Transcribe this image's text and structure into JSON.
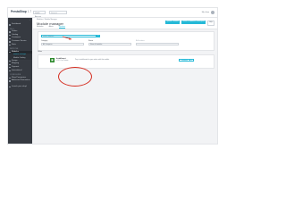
{
  "topbar": {
    "logo": "PrestaShop",
    "version": "1.7",
    "quick_access": "Quick Access",
    "search_placeholder": "Search",
    "store_label": "My shop",
    "user_icon": "user-avatar-icon"
  },
  "sidebar": {
    "collapse_icon": "chevron-left-icon",
    "items_top": [
      {
        "label": "Dashboard"
      }
    ],
    "section_sell": "SELL",
    "items_sell": [
      {
        "label": "Orders"
      },
      {
        "label": "Catalog"
      },
      {
        "label": "Customers"
      },
      {
        "label": "Customer Service"
      },
      {
        "label": "Stats"
      }
    ],
    "section_improve": "IMPROVE",
    "items_improve": [
      {
        "label": "Modules"
      }
    ],
    "modules_sub": [
      {
        "label": "Module Manager"
      },
      {
        "label": "Module Catalog"
      }
    ],
    "items_improve_more": [
      {
        "label": "Design"
      },
      {
        "label": "Shipping"
      },
      {
        "label": "Payment"
      },
      {
        "label": "International"
      }
    ],
    "section_configure": "CONFIGURE",
    "items_configure": [
      {
        "label": "Shop Parameters"
      },
      {
        "label": "Advanced Parameters"
      }
    ],
    "items_bottom": [
      {
        "label": "Launch your shop!"
      }
    ]
  },
  "header": {
    "breadcrumb": "Modules / Module Manager",
    "title": "Module manager",
    "tabs": [
      {
        "label": "Modules"
      },
      {
        "label": "Alerts"
      },
      {
        "label": "Updates"
      }
    ],
    "actions": {
      "upload": "Upload a module",
      "connect": "Connect to Addons marketplace",
      "help": "Help"
    }
  },
  "filters": {
    "search_placeholder": "Search modules",
    "search_icon": "search-icon",
    "category_label": "Category",
    "category_value": "All Categories",
    "status_label": "Status",
    "status_value": "Show all modules",
    "bulk_label": "Bulk actions",
    "bulk_value": ""
  },
  "modules_section": {
    "title": "Other",
    "module": {
      "name": "Installment",
      "version": "v1.0.0 - by Custom",
      "description": "Pay in installments for your orders with this module.",
      "action_label": "Configure",
      "dropdown_icon": "caret-down-icon"
    }
  },
  "colors": {
    "accent": "#25b9d7",
    "highlight": "#d52b1e",
    "sidebar": "#363a41",
    "module_icon": "#2d8a2d"
  }
}
